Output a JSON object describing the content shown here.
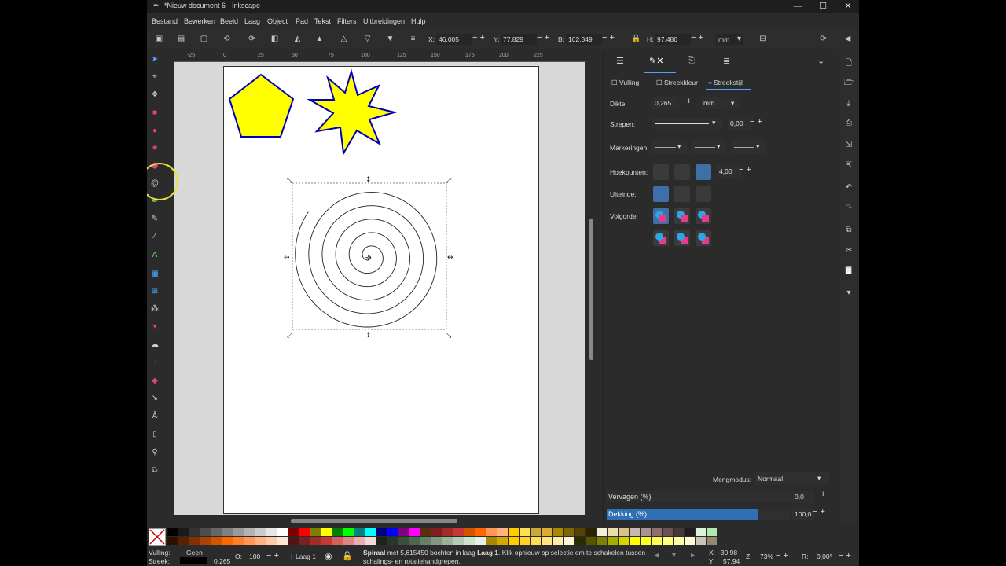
{
  "window": {
    "title": "*Nieuw document 6 - Inkscape",
    "min": "—",
    "max": "☐",
    "close": "✕"
  },
  "menu": [
    "Bestand",
    "Bewerken",
    "Beeld",
    "Laag",
    "Object",
    "Pad",
    "Tekst",
    "Filters",
    "Uitbreidingen",
    "Hulp"
  ],
  "toolbar": {
    "x_label": "X:",
    "x_value": "46,005",
    "y_label": "Y:",
    "y_value": "77,829",
    "w_label": "B:",
    "w_value": "102,349",
    "h_label": "H:",
    "h_value": "97,486",
    "unit": "mm"
  },
  "ruler_top": [
    "-25",
    "0",
    "25",
    "50",
    "75",
    "100",
    "125",
    "150",
    "175",
    "200",
    "225"
  ],
  "panel": {
    "subtabs": {
      "fill": "Vulling",
      "stroke_paint": "Streekkleur",
      "stroke_style": "Streekstijl"
    },
    "width_label": "Dikte:",
    "width_value": "0,265",
    "width_unit": "mm",
    "dashes_label": "Strepen:",
    "dashes_value": "0,00",
    "markers_label": "Markeringen:",
    "join_label": "Hoekpunten:",
    "join_value": "4,00",
    "cap_label": "Uiteinde:",
    "order_label": "Volgorde:",
    "blend_label": "Mengmodus:",
    "blend_value": "Normaal",
    "blur_label": "Vervagen (%)",
    "blur_value": "0,0",
    "opacity_label": "Dekking (%)",
    "opacity_value": "100,0",
    "opacity_fraction": 0.82
  },
  "status": {
    "fill_label": "Vulling:",
    "fill_value": "Geen",
    "stroke_label": "Streek:",
    "stroke_width": "0,265",
    "opacity_label": "O:",
    "opacity_value": "100",
    "layer": "Laag 1",
    "message_bold": "Spiraal",
    "message_mid": " met 5,615450 bochten in laag ",
    "message_layer": "Laag 1",
    "message_rest": ". Klik opnieuw op selectie om te schakelen tussen",
    "message_line2": "schalings- en rotatiehandgrepen.",
    "x_label": "X:",
    "x_value": "-30,98",
    "y_label": "Y:",
    "y_value": "57,94",
    "zoom_label": "Z:",
    "zoom_value": "73%",
    "rot_label": "R:",
    "rot_value": "0,00°"
  },
  "colors": {
    "fill_yellow": "#ffff00",
    "stroke_blue": "#0000b4",
    "accent": "#2f6fb5",
    "palette": [
      "#000000",
      "#1a1a1a",
      "#333333",
      "#4d4d4d",
      "#666666",
      "#808080",
      "#999999",
      "#b3b3b3",
      "#cccccc",
      "#e6e6e6",
      "#ffffff",
      "#800000",
      "#ff0000",
      "#808000",
      "#ffff00",
      "#008000",
      "#00ff00",
      "#008080",
      "#00ffff",
      "#000080",
      "#0000ff",
      "#800080",
      "#ff00ff",
      "#5a2d0c",
      "#7f1e1e",
      "#a52a2a",
      "#c83737",
      "#d45500",
      "#ff6600",
      "#ff9955",
      "#ffb380",
      "#ffcc00",
      "#ffdd55",
      "#c8ab37",
      "#ddaa33",
      "#aa8800",
      "#806600",
      "#554400",
      "#2b2200",
      "#f4eed7",
      "#e9ddaf",
      "#dbc28c",
      "#c8b7b7",
      "#ac9393",
      "#916f6f",
      "#6c5353",
      "#483737",
      "#241c1c",
      "#d7f4d7",
      "#afe9af"
    ]
  }
}
